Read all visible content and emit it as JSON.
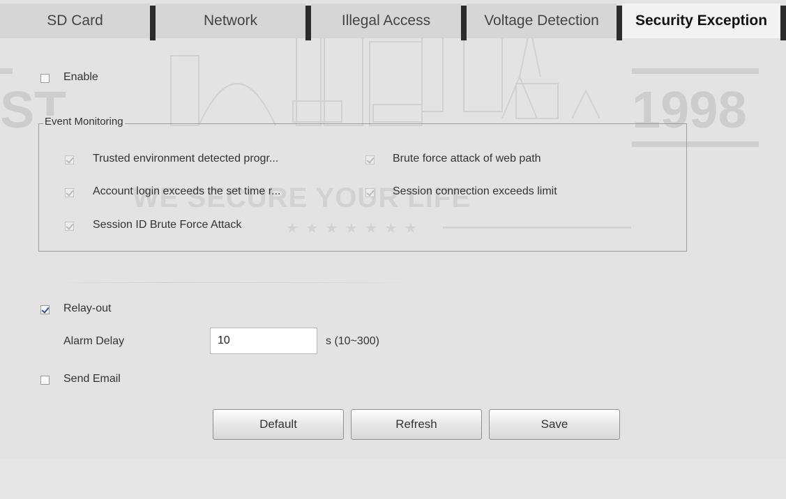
{
  "tabs": [
    {
      "label": "SD Card",
      "active": false
    },
    {
      "label": "Network",
      "active": false
    },
    {
      "label": "Illegal Access",
      "active": false
    },
    {
      "label": "Voltage Detection",
      "active": false
    },
    {
      "label": "Security Exception",
      "active": true
    }
  ],
  "watermark": {
    "left_text": "ST",
    "right_text": "1998",
    "slogan": "WE SECURE YOUR LIFE",
    "stars": "★ ★ ★ ★ ★ ★ ★"
  },
  "enable": {
    "label": "Enable",
    "checked": false
  },
  "event_monitoring": {
    "legend": "Event Monitoring",
    "items": [
      {
        "label": "Trusted environment detected progr...",
        "checked": true
      },
      {
        "label": "Brute force attack of web path",
        "checked": true
      },
      {
        "label": "Account login exceeds the set time r...",
        "checked": true
      },
      {
        "label": "Session connection exceeds limit",
        "checked": true
      },
      {
        "label": "Session ID Brute Force Attack",
        "checked": true
      }
    ]
  },
  "relay_out": {
    "label": "Relay-out",
    "checked": true
  },
  "alarm_delay": {
    "label": "Alarm Delay",
    "value": "10",
    "unit": "s (10~300)"
  },
  "send_email": {
    "label": "Send Email",
    "checked": false
  },
  "buttons": {
    "default": "Default",
    "refresh": "Refresh",
    "save": "Save"
  },
  "colors": {
    "background": "#e3e3e3",
    "tab_bg": "#d6d6d6",
    "tab_active_bg": "#f2f2f2",
    "tab_separator": "#2b2b2b",
    "check_accent": "#2d4f9e"
  }
}
